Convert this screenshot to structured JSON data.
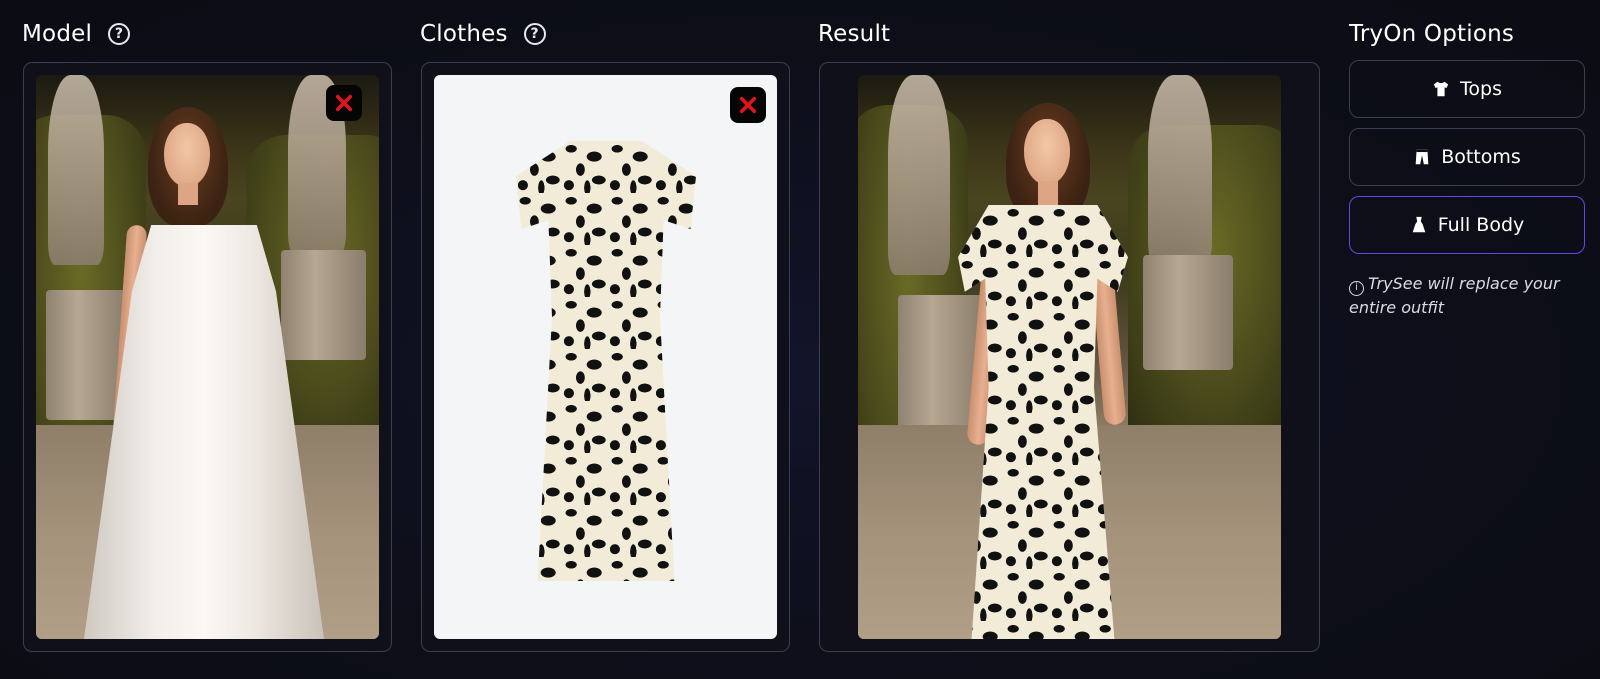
{
  "columns": {
    "model": {
      "title": "Model",
      "help_icon": "question-circle-icon",
      "remove_icon": "close-x-icon"
    },
    "clothes": {
      "title": "Clothes",
      "help_icon": "question-circle-icon",
      "remove_icon": "close-x-icon"
    },
    "result": {
      "title": "Result"
    }
  },
  "options": {
    "title": "TryOn Options",
    "buttons": [
      {
        "label": "Tops",
        "icon": "shirt-icon",
        "active": false
      },
      {
        "label": "Bottoms",
        "icon": "pants-icon",
        "active": false
      },
      {
        "label": "Full Body",
        "icon": "dress-icon",
        "active": true
      }
    ],
    "hint_icon": "info-circle-icon",
    "hint": "TrySee will replace your entire outfit"
  },
  "colors": {
    "background": "#0d0e18",
    "panel_border": "#3b3e4e",
    "active_border": "#5b4de8",
    "remove_x": "#e0141e"
  }
}
